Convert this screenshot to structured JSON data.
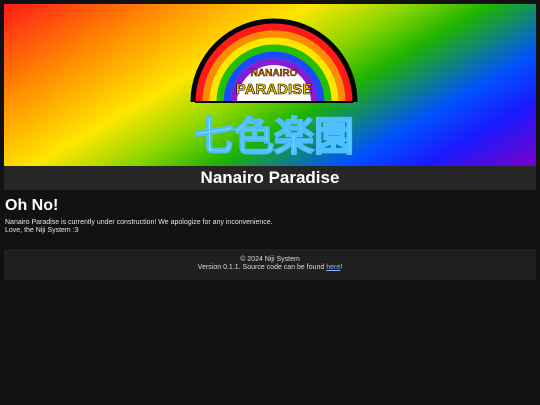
{
  "banner": {
    "logo_text_top": "NANAIRO",
    "logo_text_bottom": "PARADISE",
    "logo_kanji": "七色楽園"
  },
  "site": {
    "title": "Nanairo Paradise"
  },
  "main": {
    "heading": "Oh No!",
    "message": "Nanairo Paradise is currently under construction! We apologize for any inconvenience.",
    "signoff": "Love, the Niji System :3"
  },
  "footer": {
    "copyright": "© 2024 Niji System",
    "version_prefix": "Version 0.1.1. Source code can be found ",
    "link_text": "here",
    "suffix": "!"
  },
  "colors": {
    "background": "#111111",
    "title_bar": "#262626",
    "footer_bg": "#1f1f1f",
    "link": "#8ab4ff"
  }
}
